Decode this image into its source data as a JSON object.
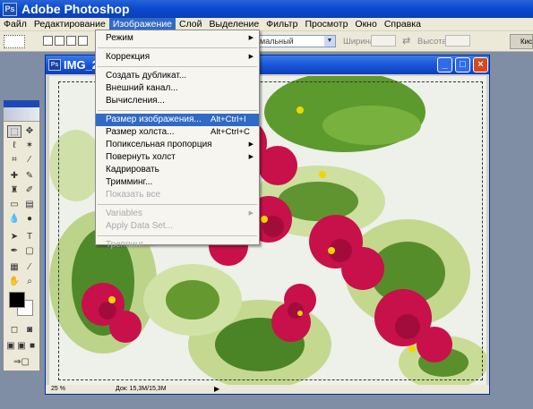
{
  "app": {
    "title": "Adobe Photoshop",
    "icon_name": "photoshop-app-icon"
  },
  "menubar": {
    "items": [
      {
        "label": "Файл"
      },
      {
        "label": "Редактирование"
      },
      {
        "label": "Изображение",
        "active": true
      },
      {
        "label": "Слой"
      },
      {
        "label": "Выделение"
      },
      {
        "label": "Фильтр"
      },
      {
        "label": "Просмотр"
      },
      {
        "label": "Окно"
      },
      {
        "label": "Справка"
      }
    ]
  },
  "options_bar": {
    "mode_value": "мальный",
    "width_label": "Ширина:",
    "height_label": "Высота:",
    "brushes_label": "Кис"
  },
  "image_menu": {
    "items": [
      {
        "label": "Режим",
        "shortcut": "",
        "submenu": true,
        "disabled": false,
        "highlighted": false
      },
      {
        "separator": true
      },
      {
        "label": "Коррекция",
        "shortcut": "",
        "submenu": true,
        "disabled": false,
        "highlighted": false
      },
      {
        "separator": true
      },
      {
        "label": "Создать дубликат...",
        "shortcut": "",
        "submenu": false,
        "disabled": false,
        "highlighted": false
      },
      {
        "label": "Внешний канал...",
        "shortcut": "",
        "submenu": false,
        "disabled": false,
        "highlighted": false
      },
      {
        "label": "Вычисления...",
        "shortcut": "",
        "submenu": false,
        "disabled": false,
        "highlighted": false
      },
      {
        "separator": true
      },
      {
        "label": "Размер изображения...",
        "shortcut": "Alt+Ctrl+I",
        "submenu": false,
        "disabled": false,
        "highlighted": true
      },
      {
        "label": "Размер холста...",
        "shortcut": "Alt+Ctrl+C",
        "submenu": false,
        "disabled": false,
        "highlighted": false
      },
      {
        "label": "Попиксельная пропорция",
        "shortcut": "",
        "submenu": true,
        "disabled": false,
        "highlighted": false
      },
      {
        "label": "Повернуть холст",
        "shortcut": "",
        "submenu": true,
        "disabled": false,
        "highlighted": false
      },
      {
        "label": "Кадрировать",
        "shortcut": "",
        "submenu": false,
        "disabled": false,
        "highlighted": false
      },
      {
        "label": "Тримминг...",
        "shortcut": "",
        "submenu": false,
        "disabled": false,
        "highlighted": false
      },
      {
        "label": "Показать все",
        "shortcut": "",
        "submenu": false,
        "disabled": true,
        "highlighted": false
      },
      {
        "separator": true
      },
      {
        "label": "Variables",
        "shortcut": "",
        "submenu": true,
        "disabled": true,
        "highlighted": false
      },
      {
        "label": "Apply Data Set...",
        "shortcut": "",
        "submenu": false,
        "disabled": true,
        "highlighted": false
      },
      {
        "separator": true
      },
      {
        "label": "Треппинг...",
        "shortcut": "",
        "submenu": false,
        "disabled": true,
        "highlighted": false
      }
    ]
  },
  "document": {
    "title": "IMG_2",
    "zoom": "25 %",
    "doc_info": "Док: 15,3M/15,3M",
    "image_description_icon": "violet-flowers-photo"
  },
  "colors": {
    "menu_highlight": "#316ac5",
    "title_bar": "#0a4bd0",
    "close_button": "#d9471d"
  }
}
